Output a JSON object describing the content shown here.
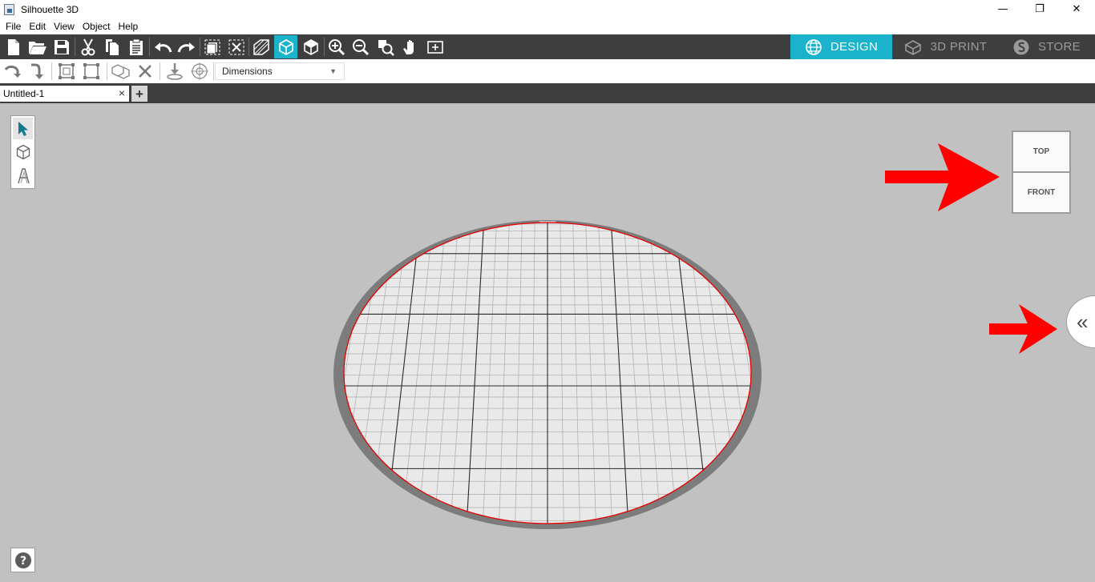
{
  "window": {
    "title": "Silhouette 3D",
    "controls": [
      "—",
      "❐",
      "✕"
    ]
  },
  "menu": [
    "File",
    "Edit",
    "View",
    "Object",
    "Help"
  ],
  "modes": {
    "design": "DESIGN",
    "print": "3D PRINT",
    "store": "STORE"
  },
  "toolbar2": {
    "dimensions_select": "Dimensions",
    "dimensions_arrow": "▼"
  },
  "document": {
    "tab": "Untitled-1",
    "close": "×",
    "add": "+"
  },
  "view_cube": {
    "top": "TOP",
    "front": "FRONT"
  },
  "panel_toggle": "«",
  "help": "?",
  "colors": {
    "accent": "#1ab3cb",
    "toolbar": "#3e3e3e",
    "canvas": "#c1c1c1",
    "annotation": "#ff0000",
    "bed_outline": "#e60000"
  },
  "icons": {
    "toolbar1": [
      "new-file-icon",
      "open-folder-icon",
      "save-icon",
      "cut-icon",
      "copy-icon",
      "paste-icon",
      "undo-icon",
      "redo-icon",
      "select-all-icon",
      "deselect-icon",
      "perspective-icon",
      "3d-view-icon",
      "iso-view-icon",
      "zoom-in-icon",
      "zoom-out-icon",
      "zoom-selection-icon",
      "pan-hand-icon",
      "fit-to-page-icon"
    ],
    "toolbar2": [
      "rotate-left-icon",
      "rotate-down-icon",
      "group-icon",
      "ungroup-icon",
      "boolean-icon",
      "delete-icon",
      "drop-to-bed-icon",
      "center-icon"
    ],
    "tools": [
      "select-arrow-icon",
      "cube-icon",
      "text-tool-icon"
    ]
  }
}
